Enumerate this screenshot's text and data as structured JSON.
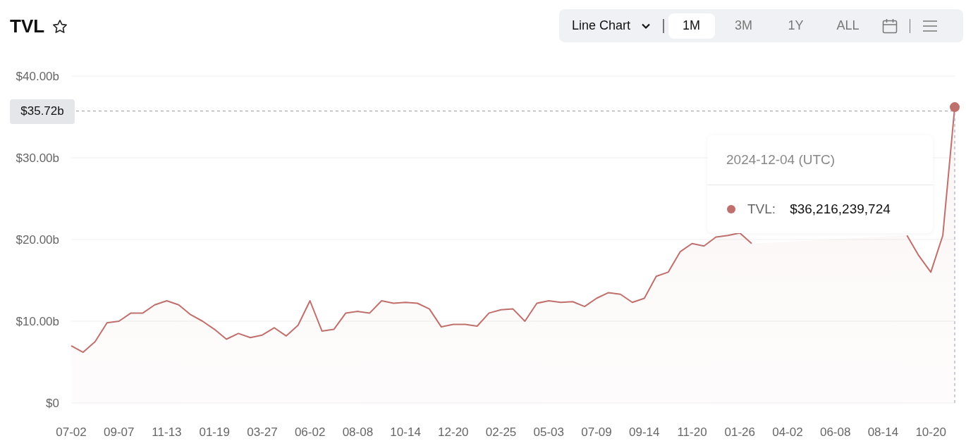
{
  "header": {
    "title": "TVL",
    "favorite": false
  },
  "toolbar": {
    "chart_type": "Line Chart",
    "ranges": [
      {
        "label": "1M",
        "selected": true
      },
      {
        "label": "3M",
        "selected": false
      },
      {
        "label": "1Y",
        "selected": false
      },
      {
        "label": "ALL",
        "selected": false
      }
    ]
  },
  "chart": {
    "chart_data": {
      "type": "area",
      "grid": true,
      "categories": [
        "07-02",
        null,
        null,
        null,
        "09-07",
        null,
        null,
        null,
        "11-13",
        null,
        null,
        null,
        "01-19",
        null,
        null,
        null,
        "03-27",
        null,
        null,
        null,
        "06-02",
        null,
        null,
        null,
        "08-08",
        null,
        null,
        null,
        "10-14",
        null,
        null,
        null,
        "12-20",
        null,
        null,
        null,
        "02-25",
        null,
        null,
        null,
        "05-03",
        null,
        null,
        null,
        "07-09",
        null,
        null,
        null,
        "09-14",
        null,
        null,
        null,
        "11-20",
        null,
        null,
        null,
        "01-26",
        null,
        null,
        null,
        "04-02",
        null,
        null,
        null,
        "06-08",
        null,
        null,
        null,
        "08-14",
        null,
        null,
        null,
        "10-20",
        null,
        null
      ],
      "series": [
        {
          "color": "#c0706c",
          "values": [
            7.0,
            6.2,
            7.5,
            9.8,
            10.0,
            11.0,
            11.0,
            12.0,
            12.5,
            12.0,
            10.8,
            10.0,
            9.0,
            7.8,
            8.5,
            8.0,
            8.3,
            9.2,
            8.2,
            9.5,
            12.5,
            8.8,
            9.0,
            11.0,
            11.2,
            11.0,
            12.5,
            12.2,
            12.3,
            12.2,
            11.5,
            9.3,
            9.6,
            9.6,
            9.4,
            11.0,
            11.4,
            11.5,
            10.0,
            12.2,
            12.5,
            12.3,
            12.4,
            11.8,
            12.8,
            13.5,
            13.3,
            12.3,
            12.8,
            15.5,
            16.0,
            18.5,
            19.5,
            19.2,
            20.3,
            20.5,
            20.8,
            19.5,
            null,
            null,
            null,
            null,
            null,
            null,
            null,
            null,
            null,
            null,
            null,
            null,
            20.5,
            18.0,
            16.0,
            20.5,
            36.2
          ]
        }
      ],
      "ylim": [
        0,
        40
      ],
      "yticks": [
        {
          "value": 0,
          "label": "$0"
        },
        {
          "value": 10,
          "label": "$10.00b"
        },
        {
          "value": 20,
          "label": "$20.00b"
        },
        {
          "value": 30,
          "label": "$30.00b"
        },
        {
          "value": 40,
          "label": "$40.00b"
        }
      ],
      "ref_lines": [
        {
          "axis": "y",
          "value": 35.72,
          "label": "$35.72b"
        }
      ]
    },
    "tooltip": {
      "date": "2024-12-04 (UTC)",
      "series": "TVL:",
      "value": "$36,216,239,724"
    }
  }
}
